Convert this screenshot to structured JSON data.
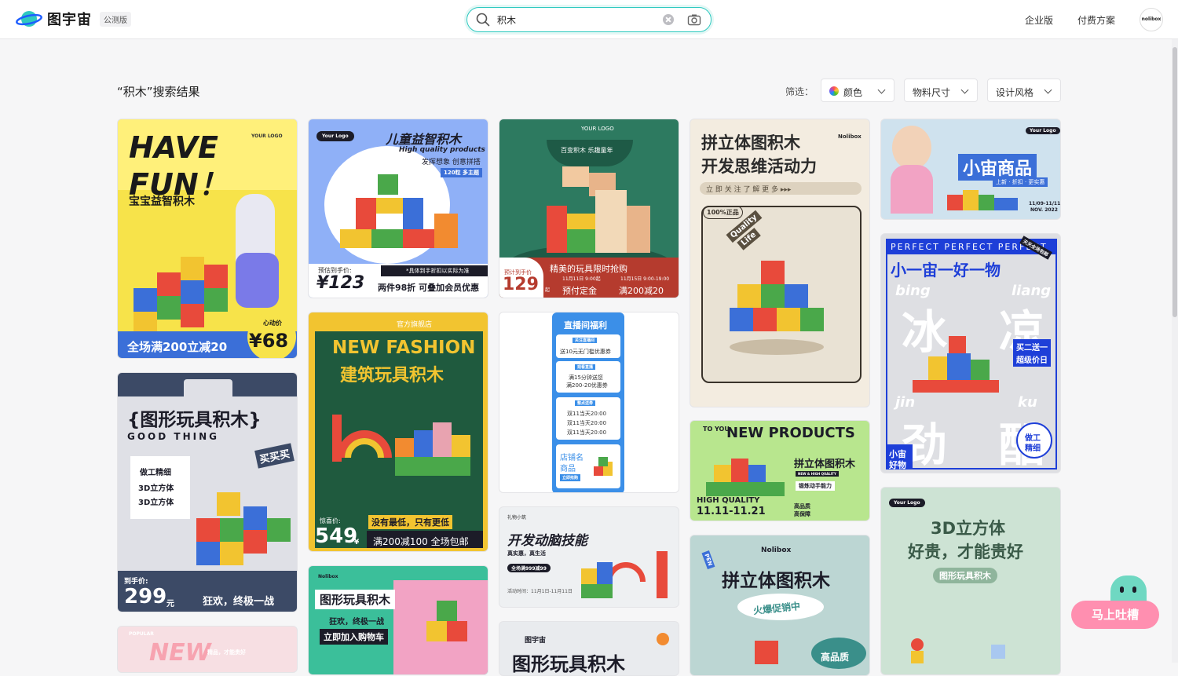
{
  "header": {
    "logo_text": "图宇宙",
    "beta_badge": "公测版",
    "search": {
      "value": "积木",
      "placeholder": ""
    },
    "nav": {
      "enterprise": "企业版",
      "pricing": "付费方案"
    },
    "avatar_text": "nolibox"
  },
  "results": {
    "title": "“积木”搜索结果",
    "filter_label": "筛选：",
    "filters": [
      {
        "label": "颜色",
        "icon": "color-wheel-icon"
      },
      {
        "label": "物料尺寸"
      },
      {
        "label": "设计风格"
      }
    ]
  },
  "cards": {
    "c1": {
      "line1": "HAVE",
      "line2": "FUN！",
      "sub": "宝宝益智积木",
      "logo": "YOUR LOGO",
      "promo": "全场满200立减20",
      "price_tag": "心动价",
      "price": "¥68"
    },
    "c2": {
      "title": "儿童益智积木",
      "en": "High quality products",
      "sub": "发挥想象 创意拼搭",
      "badge": "120粒 多主题",
      "logo": "Your Logo",
      "note": "*具体到手折扣以实际为准",
      "price_label": "预估到手价:",
      "price": "¥123",
      "promo": "两件98折 可叠加会员优惠"
    },
    "c3": {
      "logo": "YOUR LOGO",
      "ribbon": "百变积木 乐趣童年",
      "price_label": "预计到手价",
      "price": "129",
      "unit": "起",
      "slogan": "精美的玩具限时抢购",
      "date1": "11月11日 9:00起",
      "date2": "11月15日 9:00-19:00",
      "deposit": "预付定金",
      "discount": "满200减20"
    },
    "c4": {
      "title1": "拼立体图积木",
      "title2": "开发思维活动力",
      "logo": "Nolibox",
      "bar": "立 即 关 注    了 解 更 多 ▸▸▸",
      "stamp": "100%正品",
      "tag1": "Quality",
      "tag2": "Life"
    },
    "c5": {
      "logo": "Your Logo",
      "title": "小宙商品",
      "sub": "上新 · 折扣 · 更实惠",
      "date1": "11/09-11/11",
      "date2": "NOV. 2022"
    },
    "c6": {
      "title": "{图形玩具积木}",
      "sub": "GOOD THING",
      "tag": "买买买",
      "f1": "做工精细",
      "f2": "3D立方体",
      "f3": "3D立方体",
      "price_label": "到手价:",
      "price": "299",
      "unit": "元",
      "slogan": "狂欢，终极一战"
    },
    "c7": {
      "store": "官方旗舰店",
      "title1": "NEW FASHION",
      "title2": "建筑玩具积木",
      "price_label": "惊喜价:",
      "price": "549",
      "unit": "¥",
      "slogan": "没有最低，只有更低",
      "promo": "满200减100 全场包邮"
    },
    "c8": {
      "title": "直播间福利",
      "b1": "关注直播间",
      "b1t": "送10元无门槛优惠券",
      "b2": "观看直播",
      "b2t1": "满15分钟送您",
      "b2t2": "满200-20优惠券",
      "b3": "整点送券",
      "b3t1": "双11当天20:00",
      "b3t2": "双11当天20:00",
      "b3t3": "双11当天20:00",
      "store1": "店铺名",
      "store2": "商品",
      "store_btn": "立即抢购"
    },
    "c9": {
      "top": "NEW PRODUCTS",
      "to": "TO YOU",
      "title": "拼立体图积木",
      "badge": "NEW & HIGH QUALITY",
      "sub": "锻炼动手能力",
      "hq": "HIGH QUALITY",
      "date": "11.11-11.21",
      "q1": "高品质",
      "q2": "高保障"
    },
    "c10": {
      "top": "PERFECT PERFECT PERFECT",
      "title": "小一宙一好一物",
      "py1": "bing",
      "py2": "liang",
      "cn1": "冰",
      "cn2": "凉",
      "deal1": "买二送一",
      "deal2": "超级价日",
      "py3": "jin",
      "py4": "ku",
      "cn3": "劲",
      "cn4": "酷",
      "badge1": "做工",
      "badge2": "精细",
      "corner": "天天全场包邮",
      "tag1": "小宙",
      "tag2": "好物"
    },
    "c11": {
      "brand": "礼物小筑",
      "title": "开发动脑技能",
      "sub": "真实惠，真生活",
      "tag": "全场满999减99",
      "date": "活动时间：11月1日-11月11日"
    },
    "c12": {
      "logo": "Nolibox",
      "title": "图形玩具积木",
      "slogan": "狂欢，终极一战",
      "cta": "立即加入购物车"
    },
    "c13": {
      "logo": "Nolibox",
      "title": "拼立体图积木",
      "sub": "火爆促销中",
      "tag": "PEN",
      "corner": "高品质"
    },
    "c14": {
      "logo": "Your Logo",
      "title1": "3D立方体",
      "title2": "好贵，才能贵好",
      "sub": "图形玩具积木"
    },
    "c15": {
      "tag": "POPULAR",
      "title": "NEW",
      "sub": "精品，才能贵好"
    },
    "c16": {
      "logo": "图宇宙",
      "title": "图形玩具积木"
    }
  },
  "feedback": {
    "label": "马上吐槽"
  },
  "colors": {
    "accent": "#2fc9c0",
    "feedback": "#ff8fb0"
  }
}
